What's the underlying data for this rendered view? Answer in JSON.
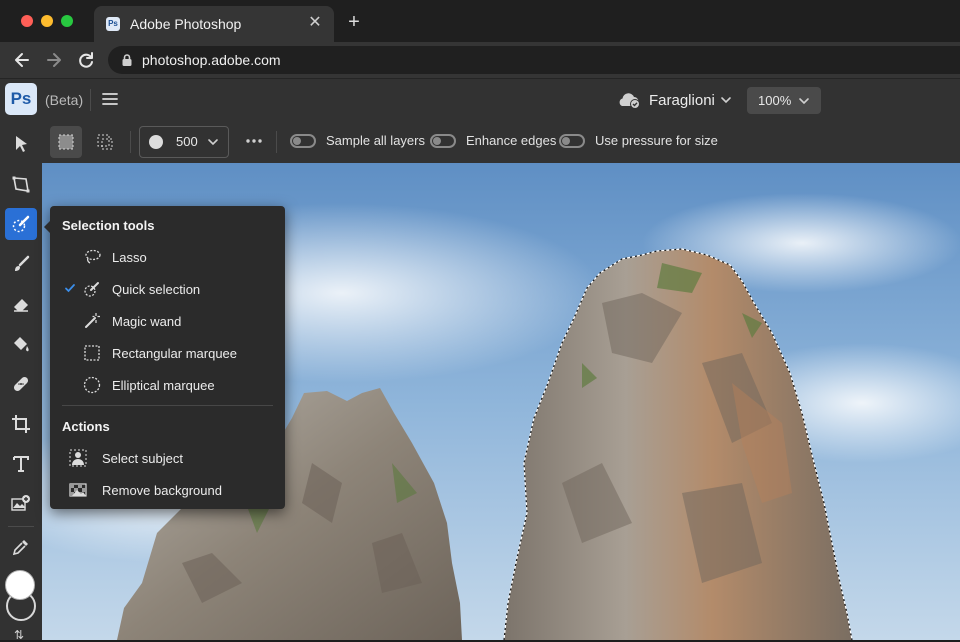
{
  "browser": {
    "tab_title": "Adobe Photoshop",
    "tab_favicon": "Ps",
    "url": "photoshop.adobe.com",
    "icons": [
      "close-icon",
      "plus-icon",
      "back-arrow-icon",
      "forward-arrow-icon",
      "reload-icon",
      "lock-icon"
    ]
  },
  "app": {
    "logo": "Ps",
    "beta_label": "(Beta)",
    "document_name": "Faraglioni",
    "zoom": "100%",
    "accent_color": "#2a70d6"
  },
  "options_bar": {
    "brush_size": "500",
    "toggles": [
      {
        "label": "Sample all layers",
        "on": false
      },
      {
        "label": "Enhance edges",
        "on": false
      },
      {
        "label": "Use pressure for size",
        "on": false
      }
    ]
  },
  "toolbar": {
    "tools": [
      "move-tool",
      "transform-tool",
      "quick-selection-tool",
      "brush-tool",
      "eraser-tool",
      "fill-tool",
      "healing-tool",
      "crop-tool",
      "type-tool",
      "add-image-tool",
      "eyedropper-tool"
    ],
    "active_tool": "quick-selection-tool",
    "foreground_color": "#ffffff"
  },
  "flyout": {
    "heading_selection": "Selection tools",
    "selection_items": [
      {
        "label": "Lasso",
        "icon": "lasso-icon",
        "checked": false
      },
      {
        "label": "Quick selection",
        "icon": "quick-selection-icon",
        "checked": true
      },
      {
        "label": "Magic wand",
        "icon": "magic-wand-icon",
        "checked": false
      },
      {
        "label": "Rectangular marquee",
        "icon": "rectangular-marquee-icon",
        "checked": false
      },
      {
        "label": "Elliptical marquee",
        "icon": "elliptical-marquee-icon",
        "checked": false
      }
    ],
    "heading_actions": "Actions",
    "action_items": [
      {
        "label": "Select subject",
        "icon": "select-subject-icon"
      },
      {
        "label": "Remove background",
        "icon": "remove-background-icon"
      }
    ]
  }
}
